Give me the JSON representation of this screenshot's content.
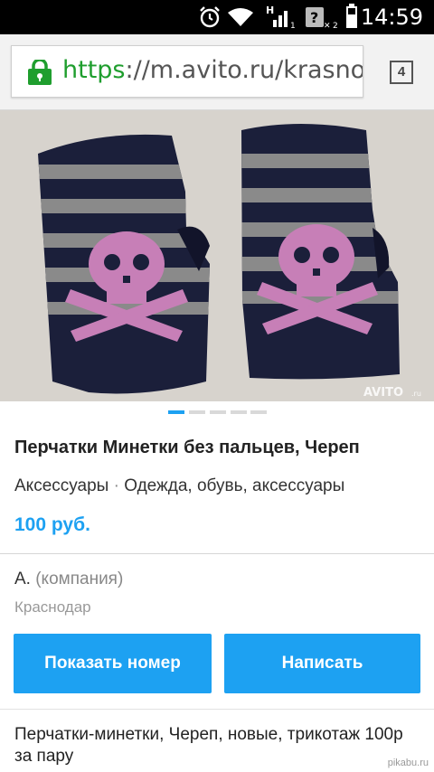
{
  "status_bar": {
    "time": "14:59",
    "icons": [
      "alarm-icon",
      "wifi-icon",
      "signal-h-icon",
      "sim2-icon",
      "battery-icon"
    ],
    "signal_label": "H",
    "sim1": "1",
    "sim2": "2"
  },
  "browser": {
    "url_scheme": "https",
    "url_rest": "://m.avito.ru/krasnodar",
    "tab_count": "4",
    "lock_color": "#1f9e2e"
  },
  "gallery": {
    "photo_watermark": "AVITO",
    "photo_subscript": ".ru",
    "slide_count": 5,
    "active_slide": 1
  },
  "listing": {
    "title": "Перчатки Минетки без пальцев, Череп",
    "category": "Аксессуары",
    "category_separator": "·",
    "parent_category": "Одежда, обувь, аксессуары",
    "price": "100 руб."
  },
  "seller": {
    "name": "А.",
    "type": "(компания)",
    "city": "Краснодар"
  },
  "actions": {
    "show_phone": "Показать номер",
    "write": "Написать"
  },
  "description": {
    "text": "Перчатки-минетки, Череп, новые, трикотаж 100р за пару"
  },
  "footer": {
    "watermark": "pikabu.ru"
  },
  "colors": {
    "accent": "#1da1f2",
    "status_bar_bg": "#000000",
    "glove_navy": "#1b1f3a",
    "glove_gray": "#8a8a8a",
    "skull_pink": "#c77fb7"
  }
}
